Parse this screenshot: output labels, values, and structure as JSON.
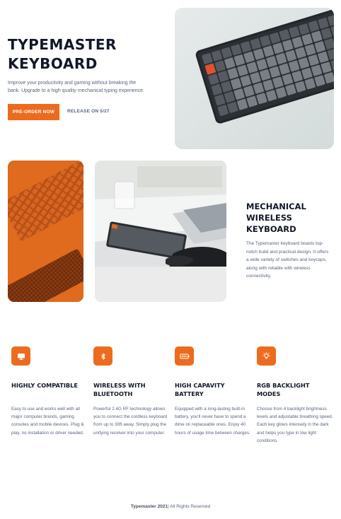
{
  "hero": {
    "title": "TYPEMASTER KEYBOARD",
    "description": "Improve your productivity and gaming without breaking the bank. Upgrade to a high quality mechanical typing experience.",
    "primary_button": "PRE-ORDER NOW",
    "release_link": "RELEASE ON 5/27"
  },
  "feature_block": {
    "title": "MECHANICAL WIRELESS KEYBOARD",
    "description": "The Typemaster keyboard boasts top-notch build and practical design. It offers a wide variety of switches and keycaps, along with reliable with wireless connectivity."
  },
  "features": [
    {
      "icon": "monitor-icon",
      "title": "HIGHLY COMPATIBLE",
      "description": "Easy to use and works well with all major computer brands, gaming consoles and mobile devices. Plug & play, no installation or driver needed."
    },
    {
      "icon": "bluetooth-icon",
      "title": "WIRELESS WITH BLUETOOTH",
      "description": "Powerful 2.4G RF technology allows you to connect the cordless keyboard from up to 30ft away. Simply plug the unifying receiver into your computer."
    },
    {
      "icon": "battery-icon",
      "title": "HIGH CAPAVITY BATTERY",
      "description": "Equipped with a long-lasting built-in battery, you'll never have to spend a dime on replaceable ones. Enjoy 40 hours of usage time between charges."
    },
    {
      "icon": "lightbulb-icon",
      "title": "RGB BACKLIGHT MODES",
      "description": "Choose from 4 backlight brightness levels and adjustable breathing speed. Each key glows intensely in the dark and helps you type in low light conditions."
    }
  ],
  "footer": {
    "brand": "Typemaster 2021",
    "rights": "| All Rights Reserved"
  },
  "colors": {
    "accent": "#ed6b1e",
    "heading": "#111827",
    "body_text": "#5a6480"
  }
}
